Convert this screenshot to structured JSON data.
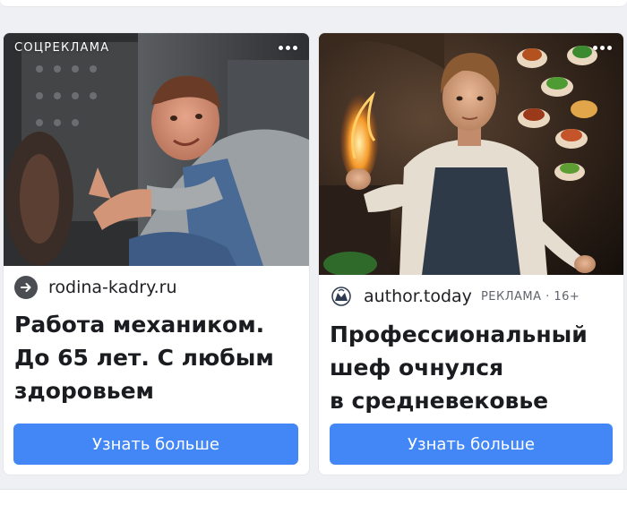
{
  "cards": [
    {
      "tag": "СОЦРЕКЛАМА",
      "domain": "rodina-kadry.ru",
      "meta": "",
      "title": "Работа механиком.\nДо 65 лет. С любым\nздоровьем",
      "cta": "Узнать больше",
      "image": "mechanic-thumbs-up-photo",
      "source_icon": "arrow-right-icon"
    },
    {
      "tag": "",
      "domain": "author.today",
      "meta": "РЕКЛАМА · 16+",
      "title": "Профессиональный\nшеф очнулся\nв средневековье",
      "cta": "Узнать больше",
      "image": "medieval-chef-fire-photo",
      "source_icon": "author-today-logo-icon"
    }
  ],
  "colors": {
    "cta": "#4287f5",
    "page_bg": "#eef0f3"
  }
}
